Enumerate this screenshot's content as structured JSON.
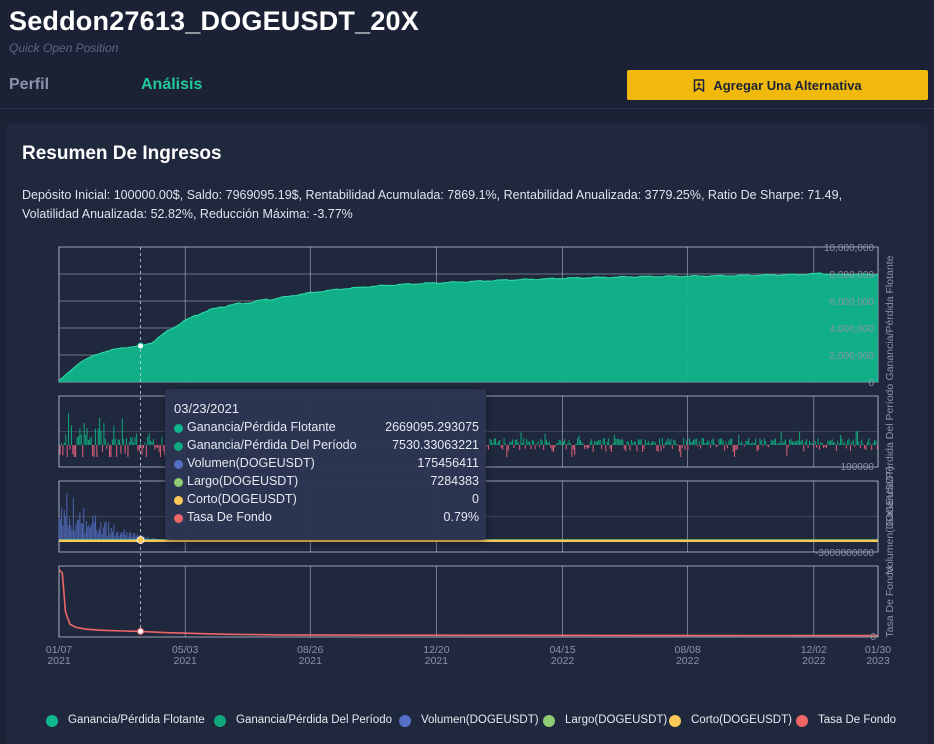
{
  "header": {
    "title": "Seddon27613_DOGEUSDT_20X",
    "subtitle": "Quick Open Position",
    "tabs": [
      {
        "label": "Perfil"
      },
      {
        "label": "Análisis"
      }
    ],
    "add_button_label": "Agregar Una Alternativa",
    "add_button_icon": "bookmark-plus-icon"
  },
  "summary": {
    "title": "Resumen De Ingresos",
    "stats_line1": "Depósito Inicial: 100000.00$, Saldo: 7969095.19$, Rentabilidad Acumulada: 7869.1%, Rentabilidad Anualizada: 3779.25%, Ratio De Sharpe: 71.49,",
    "stats_line2": "Volatilidad Anualizada: 52.82%, Reducción Máxima: -3.77%"
  },
  "colors": {
    "floating": "#10b68c",
    "period": "#0fa87c",
    "volume": "#5470c6",
    "long": "#91cc75",
    "short": "#fac858",
    "funding": "#ee6666",
    "period_neg": "#e0617a"
  },
  "chart_data": {
    "type": "area",
    "x_axis_labels": [
      {
        "date": "01/07",
        "year": "2021"
      },
      {
        "date": "05/03",
        "year": "2021"
      },
      {
        "date": "08/26",
        "year": "2021"
      },
      {
        "date": "12/20",
        "year": "2021"
      },
      {
        "date": "04/15",
        "year": "2022"
      },
      {
        "date": "08/08",
        "year": "2022"
      },
      {
        "date": "12/02",
        "year": "2022"
      },
      {
        "date": "01/30",
        "year": "2023"
      }
    ],
    "x_axis_label_days": [
      0,
      116,
      231,
      347,
      463,
      578,
      694,
      753
    ],
    "panels": [
      {
        "name": "Ganancia/Pérdida Flotante",
        "axis_label": "Ganancia/Pérdida Flotante",
        "y_ticks": [
          "10,000,000",
          "8,000,000",
          "6,000,000",
          "4,000,000",
          "2,000,000",
          "0"
        ],
        "ylim": [
          0,
          10000000
        ],
        "series_days": [
          0,
          10,
          20,
          30,
          40,
          50,
          60,
          75,
          85,
          100,
          115,
          130,
          150,
          175,
          200,
          230,
          260,
          290,
          320,
          350,
          380,
          410,
          440,
          470,
          500,
          530,
          560,
          590,
          620,
          650,
          680,
          700,
          715,
          730,
          753
        ],
        "series_values": [
          100000,
          800000,
          1500000,
          1900000,
          2200000,
          2400000,
          2550000,
          2669095,
          2900000,
          3800000,
          4500000,
          5100000,
          5600000,
          5900000,
          6200000,
          6600000,
          6900000,
          7100000,
          7250000,
          7350000,
          7450000,
          7550000,
          7620000,
          7700000,
          7750000,
          7800000,
          7830000,
          7850000,
          7880000,
          7920000,
          7950000,
          8050000,
          7950000,
          7969095,
          7969095
        ]
      },
      {
        "name": "Ganancia/Pérdida Del Período",
        "axis_label": "Ganancia/Pérdida Del Período",
        "y_ticks": [
          "100000"
        ]
      },
      {
        "name": "Volumen(DOGEUSDT)",
        "axis_label": "Volumen(DOGEUSDT)",
        "y_ticks": [
          "-3000000000"
        ]
      },
      {
        "name": "Tasa De Fondo",
        "axis_label": "Tasa De Fondo",
        "y_ticks": [
          "0"
        ],
        "series_days": [
          0,
          3,
          6,
          10,
          15,
          25,
          40,
          60,
          75,
          100,
          150,
          200,
          300,
          753
        ],
        "series_values": [
          9.5,
          9.0,
          3.5,
          1.8,
          1.4,
          1.1,
          0.95,
          0.85,
          0.79,
          0.6,
          0.4,
          0.3,
          0.25,
          0.2
        ],
        "ylim": [
          0,
          10
        ]
      }
    ],
    "tooltip_day": 75
  },
  "tooltip": {
    "date": "03/23/2021",
    "rows": [
      {
        "label": "Ganancia/Pérdida Flotante",
        "value": "2669095.293075",
        "color": "#10b68c"
      },
      {
        "label": "Ganancia/Pérdida Del Período",
        "value": "7530.33063221",
        "color": "#0fa87c"
      },
      {
        "label": "Volumen(DOGEUSDT)",
        "value": "175456411",
        "color": "#5470c6"
      },
      {
        "label": "Largo(DOGEUSDT)",
        "value": "7284383",
        "color": "#91cc75"
      },
      {
        "label": "Corto(DOGEUSDT)",
        "value": "0",
        "color": "#fac858"
      },
      {
        "label": "Tasa De Fondo",
        "value": "0.79%",
        "color": "#ee6666"
      }
    ]
  },
  "legend": [
    {
      "label": "Ganancia/Pérdida Flotante",
      "color": "#10b68c"
    },
    {
      "label": "Ganancia/Pérdida Del Período",
      "color": "#0fa87c"
    },
    {
      "label": "Volumen(DOGEUSDT)",
      "color": "#5470c6"
    },
    {
      "label": "Largo(DOGEUSDT)",
      "color": "#91cc75"
    },
    {
      "label": "Corto(DOGEUSDT)",
      "color": "#fac858"
    },
    {
      "label": "Tasa De Fondo",
      "color": "#ee6666"
    }
  ]
}
